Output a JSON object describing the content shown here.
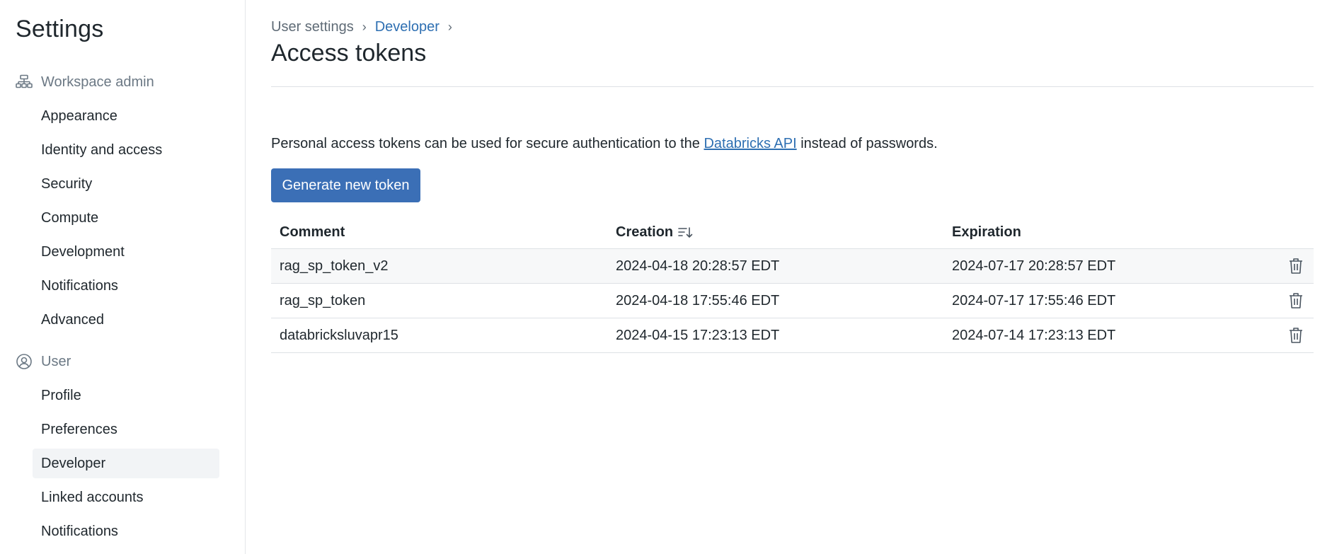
{
  "sidebar": {
    "title": "Settings",
    "workspace_admin": {
      "label": "Workspace admin",
      "icon": "workspace-admin-icon",
      "items": [
        "Appearance",
        "Identity and access",
        "Security",
        "Compute",
        "Development",
        "Notifications",
        "Advanced"
      ]
    },
    "user": {
      "label": "User",
      "icon": "user-circle-icon",
      "items": [
        "Profile",
        "Preferences",
        "Developer",
        "Linked accounts",
        "Notifications"
      ],
      "active": "Developer"
    }
  },
  "breadcrumb": {
    "items": [
      "User settings",
      "Developer"
    ],
    "separator": "›"
  },
  "page": {
    "title": "Access tokens",
    "description_before": "Personal access tokens can be used for secure authentication to the ",
    "description_link": "Databricks API",
    "description_after": " instead of passwords.",
    "generate_button": "Generate new token"
  },
  "table": {
    "columns": {
      "comment": "Comment",
      "creation": "Creation",
      "expiration": "Expiration"
    },
    "rows": [
      {
        "comment": "rag_sp_token_v2",
        "creation": "2024-04-18 20:28:57 EDT",
        "expiration": "2024-07-17 20:28:57 EDT"
      },
      {
        "comment": "rag_sp_token",
        "creation": "2024-04-18 17:55:46 EDT",
        "expiration": "2024-07-17 17:55:46 EDT"
      },
      {
        "comment": "databricksluvapr15",
        "creation": "2024-04-15 17:23:13 EDT",
        "expiration": "2024-07-14 17:23:13 EDT"
      }
    ]
  },
  "colors": {
    "accent": "#3b6fb6",
    "link": "#2e6fb2",
    "muted": "#6b7884"
  }
}
